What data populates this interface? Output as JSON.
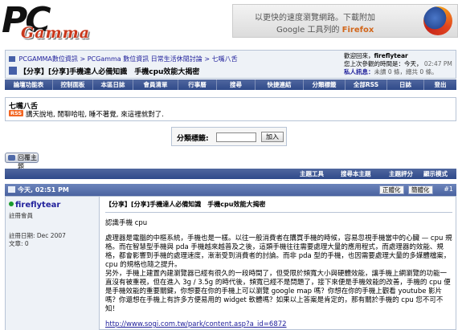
{
  "header": {
    "logo_pc": "PC",
    "logo_gamma": "Gamma",
    "ad_line1": "以更快的速度瀏覽網路。下載附加",
    "ad_line2_prefix": "Google 工具列的",
    "ad_line2_brand": "Firefox"
  },
  "breadcrumb": [
    "PCGAMMA數位資訊",
    "PCGamma 數位資訊 日常生活休閒討論",
    "七嘴八舌"
  ],
  "thread_title": "【分享】[分享]手機達人必備知識　手機cpu效能大揭密",
  "user": {
    "welcome_label": "歡迎回來，",
    "username": "fireflytear",
    "last_visit": "您上次參觀的時間是：今天，",
    "last_visit_time": "02:47 PM",
    "pm_label": "私人訊息：",
    "pm_text": "未讀 0 條，總共 0 條。"
  },
  "menu": [
    "論壇功能表",
    "控制面板",
    "本區日誌",
    "會員清單",
    "行事曆",
    "搜尋",
    "快捷連結",
    "分類標籤",
    "全部RSS",
    "日誌",
    "登出"
  ],
  "category": {
    "title": "七嘴八舌",
    "rss": "RSS",
    "desc": "講天說地, 閒聊哈啦, 睡不著覺, 來這裡就對了."
  },
  "jump": {
    "label": "分類標籤:",
    "button": "加入"
  },
  "reply_button": "回覆主題",
  "toolbar": [
    "主題工具",
    "搜尋本主題",
    "主題評分",
    "顯示模式"
  ],
  "post": {
    "date": "今天, 02:51 PM",
    "buttons": [
      "正體化",
      "簡體化"
    ],
    "number": "#1",
    "username": "fireflytear",
    "user_title": "註冊會員",
    "join_date": "註冊日期: Dec 2007",
    "posts": "文章: 0",
    "title": "【分享】[分享]手機達人必備知識　手機cpu效能大揭密",
    "p1": "認識手機 cpu",
    "p2": "處理器是電腦的中樞系統，手機也是一樣。以往一般消費者在購買手機的時候，容易忽視手機當中的心臟 — cpu 規格。而在智慧型手機與 pda 手機越來越普及之後，這類手機往往需要處理大量的應用程式，而處理器的效能、規格，都會影響到手機的處理速度，漸漸受到消費者的討論。而非 pda 型的手機，也因需要處理大量的多媒體檔案，cpu 的規格也隨之提升。",
    "p3": "另外，手機上建置內建瀏覽器已經有很久的一段時間了，但受限於頻寬大小與硬體效能，讓手機上網瀏覽的功能一直沒有被重視，但在進入 3g / 3.5g 的時代後，頻寬已經不是問題了，接下來便是手機效能的改善，手機的 cpu 便是手機效能的重要關鍵，你想要在你的手機上可以瀏覽 google map 嗎？你想在你的手機上觀看 youtube 影片嗎？你還想在手機上有許多方便易用的 widget 軟體嗎？如果以上答案是肯定的，那有關於手機的 cpu 您不可不知！",
    "url": "http://www.sogi.com.tw/park/content.asp?a_id=6872"
  }
}
